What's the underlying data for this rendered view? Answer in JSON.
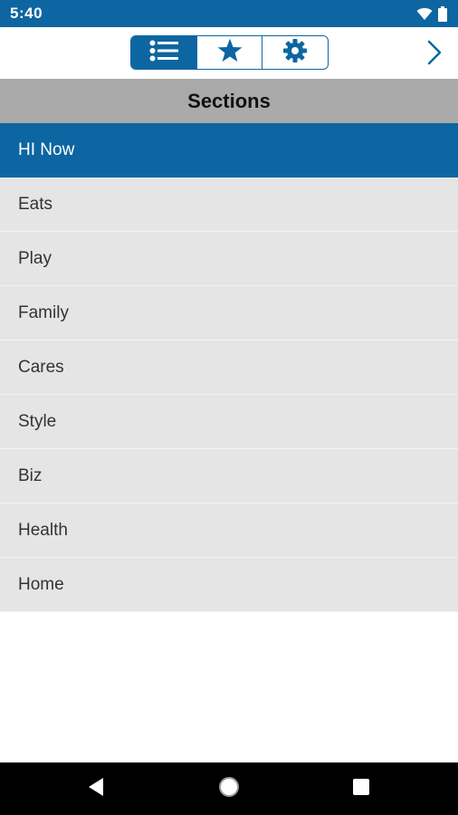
{
  "status_bar": {
    "time": "5:40",
    "icons": [
      "wifi-icon",
      "battery-icon"
    ]
  },
  "toolbar": {
    "tabs": [
      {
        "icon": "list-icon",
        "active": true
      },
      {
        "icon": "star-icon",
        "active": false
      },
      {
        "icon": "gear-icon",
        "active": false
      }
    ],
    "forward_icon": "chevron-right-icon"
  },
  "sections": {
    "title": "Sections",
    "items": [
      {
        "label": "HI Now",
        "selected": true
      },
      {
        "label": "Eats",
        "selected": false
      },
      {
        "label": "Play",
        "selected": false
      },
      {
        "label": "Family",
        "selected": false
      },
      {
        "label": "Cares",
        "selected": false
      },
      {
        "label": "Style",
        "selected": false
      },
      {
        "label": "Biz",
        "selected": false
      },
      {
        "label": "Health",
        "selected": false
      },
      {
        "label": "Home",
        "selected": false
      }
    ]
  },
  "nav_bar": {
    "icons": [
      "back-icon",
      "home-icon",
      "recents-icon"
    ]
  },
  "colors": {
    "primary": "#0d66a1",
    "header_bg": "#aaaaaa",
    "item_bg": "#e5e5e5",
    "nav_bg": "#000000"
  }
}
